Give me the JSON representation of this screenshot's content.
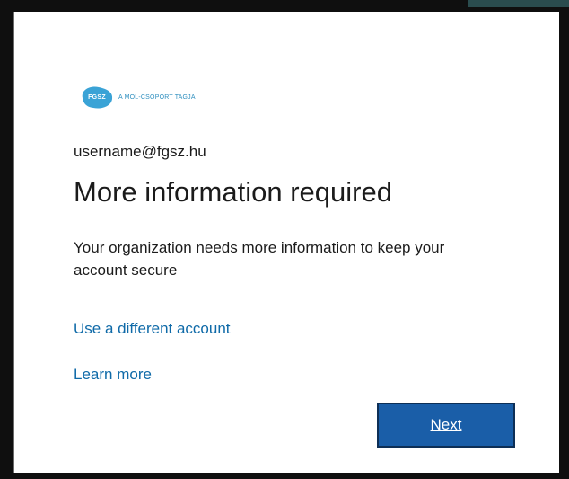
{
  "logo": {
    "mark": "FGSZ",
    "tagline": "A MOL-CSOPORT TAGJA",
    "color": "#3aa3d6"
  },
  "account": {
    "username": "username@fgsz.hu"
  },
  "heading": {
    "title": "More information required",
    "description": "Your organization needs more information to keep your account secure"
  },
  "links": {
    "different_account": "Use a different account",
    "learn_more": "Learn more"
  },
  "actions": {
    "next_label": "Next"
  },
  "colors": {
    "accent": "#1a5ea8",
    "link": "#0f6aa8"
  }
}
